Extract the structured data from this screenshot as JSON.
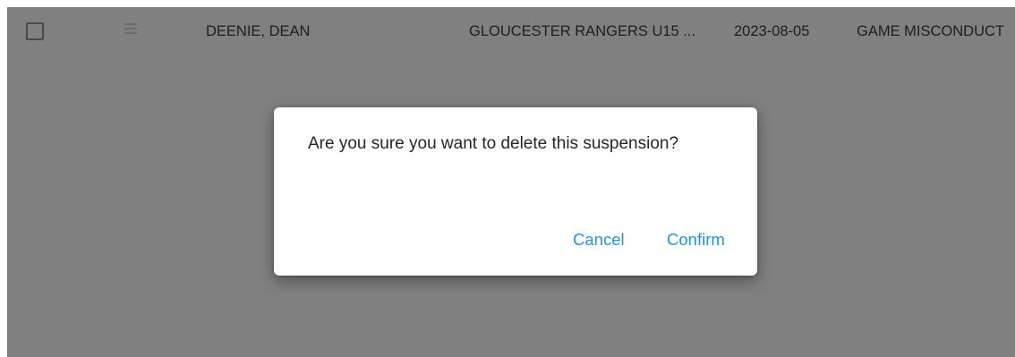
{
  "row": {
    "player_name": "DEENIE, DEAN",
    "team": "GLOUCESTER RANGERS U15 ...",
    "date": "2023-08-05",
    "infraction": "GAME MISCONDUCT"
  },
  "dialog": {
    "message": "Are you sure you want to delete this suspension?",
    "cancel_label": "Cancel",
    "confirm_label": "Confirm"
  },
  "colors": {
    "overlay": "#808080",
    "accent": "#2196d3"
  },
  "icons": {
    "row_checkbox": "checkbox-icon",
    "row_handle": "menu-icon"
  }
}
